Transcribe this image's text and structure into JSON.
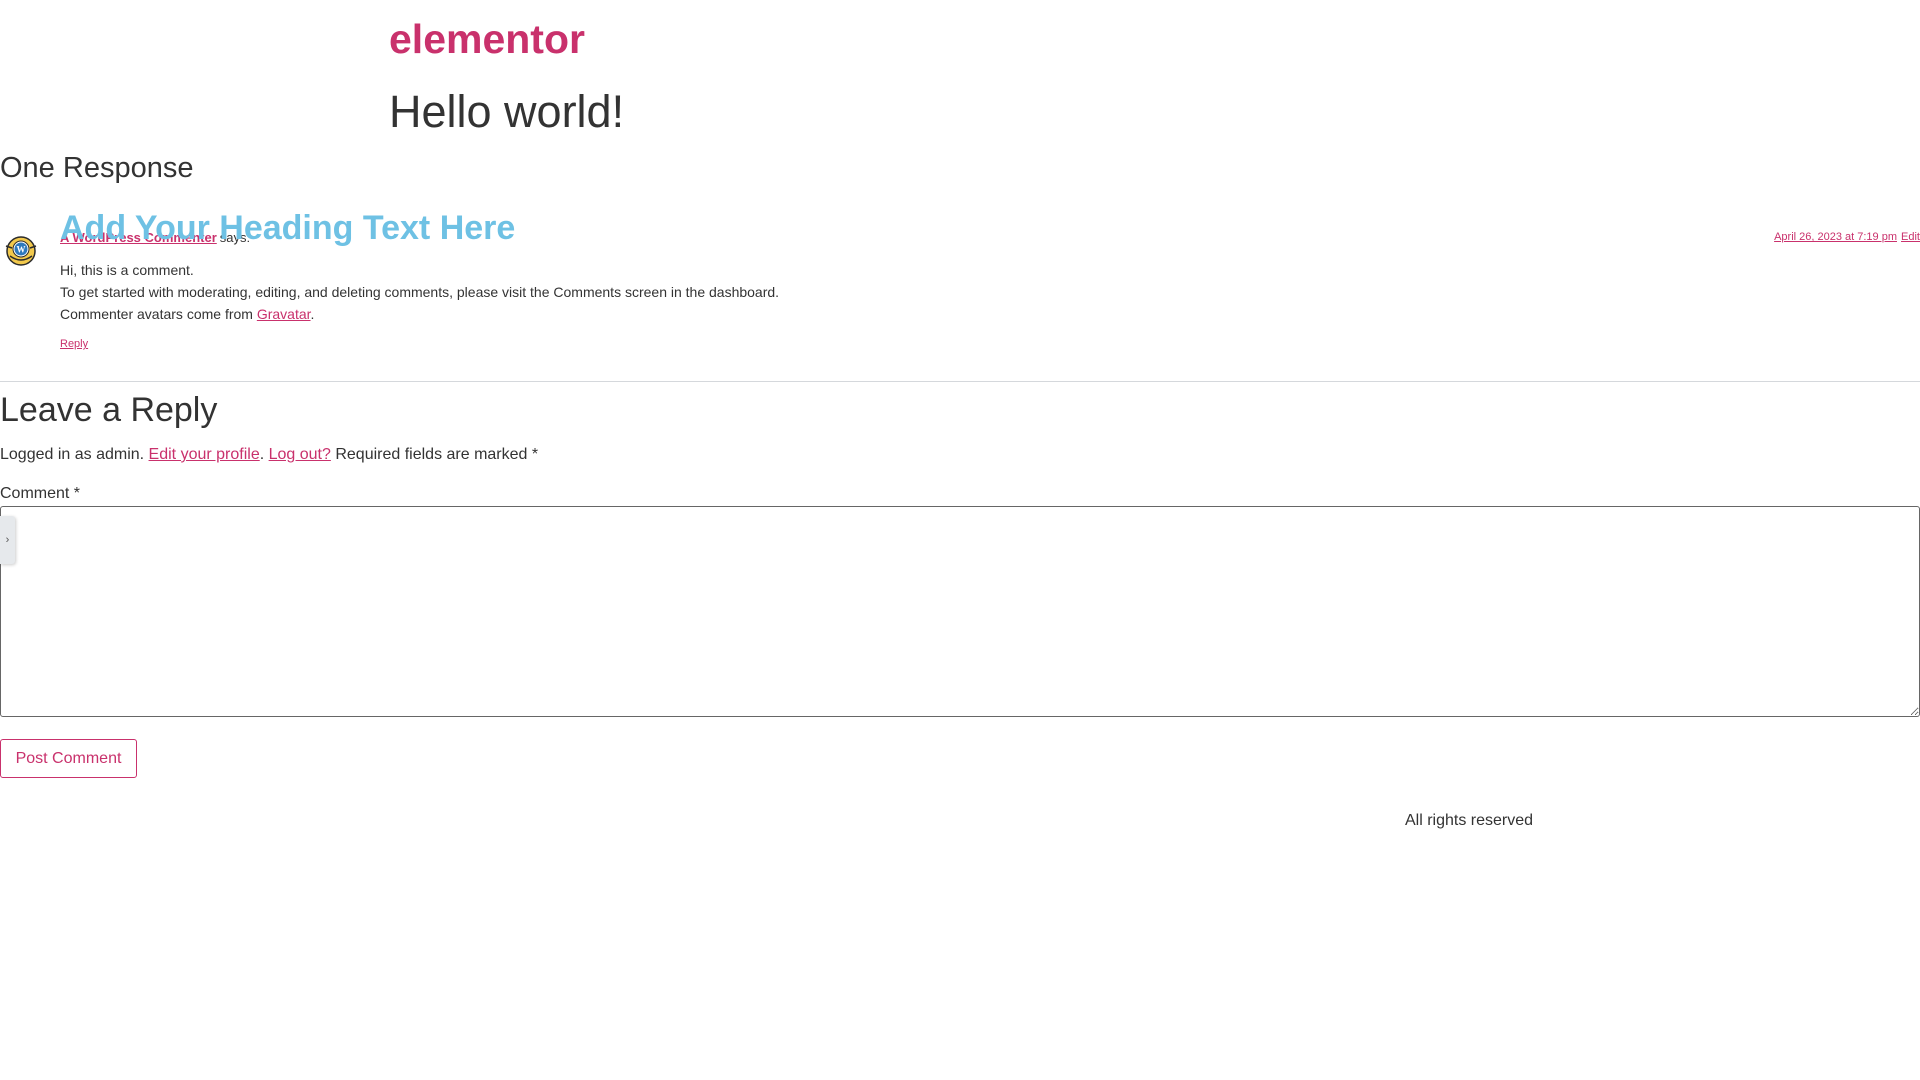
{
  "header": {
    "site_title": "elementor"
  },
  "post": {
    "title": "Hello world!"
  },
  "comments": {
    "title": "One Response",
    "overlay_heading": "Add Your Heading Text Here",
    "items": [
      {
        "author": "A WordPress Commenter",
        "says": "says:",
        "date": "April 26, 2023 at 7:19 pm",
        "edit": "Edit",
        "line1": "Hi, this is a comment.",
        "line2": "To get started with moderating, editing, and deleting comments, please visit the Comments screen in the dashboard.",
        "line3_prefix": "Commenter avatars come from ",
        "line3_link": "Gravatar",
        "line3_suffix": ".",
        "reply": "Reply"
      }
    ]
  },
  "reply_form": {
    "title": "Leave a Reply",
    "logged_in_prefix": "Logged in as admin. ",
    "edit_profile": "Edit your profile",
    "separator": ". ",
    "log_out": "Log out?",
    "required_note": " Required fields are marked *",
    "comment_label": "Comment *",
    "comment_value": "",
    "submit_label": "Post Comment",
    "edit_handle_icon": "chevron-right"
  },
  "footer": {
    "text": "All rights reserved"
  },
  "colors": {
    "accent": "#c9316c",
    "heading_blue": "#6ec1e4",
    "text": "#333333"
  }
}
